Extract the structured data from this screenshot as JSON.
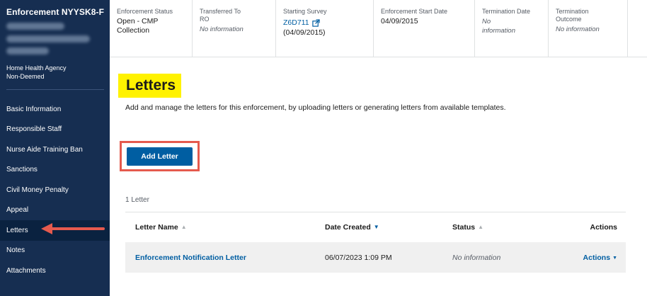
{
  "sidebar": {
    "title": "Enforcement NYYSK8-F",
    "meta_line1": "Home Health Agency",
    "meta_line2": "Non-Deemed",
    "items": [
      {
        "label": "Basic Information"
      },
      {
        "label": "Responsible Staff"
      },
      {
        "label": "Nurse Aide Training Ban"
      },
      {
        "label": "Sanctions"
      },
      {
        "label": "Civil Money Penalty"
      },
      {
        "label": "Appeal"
      },
      {
        "label": "Letters"
      },
      {
        "label": "Notes"
      },
      {
        "label": "Attachments"
      }
    ],
    "active_item": "Letters"
  },
  "infobar": {
    "enforcement_status": {
      "label": "Enforcement Status",
      "value": "Open - CMP Collection"
    },
    "transferred_to": {
      "label": "Transferred To RO",
      "value": "No information"
    },
    "starting_survey": {
      "label": "Starting Survey",
      "value": "Z6D711",
      "date": "(04/09/2015)"
    },
    "enforcement_start": {
      "label": "Enforcement Start Date",
      "value": "04/09/2015"
    },
    "termination_date": {
      "label": "Termination Date",
      "value": "No information"
    },
    "termination_outcome": {
      "label": "Termination Outcome",
      "value": "No information"
    }
  },
  "main": {
    "title": "Letters",
    "description": "Add and manage the letters for this enforcement, by uploading letters or generating letters from available templates.",
    "add_button": "Add Letter",
    "count_label": "1 Letter",
    "table": {
      "headers": {
        "name": "Letter Name",
        "date": "Date Created",
        "status": "Status",
        "actions": "Actions"
      },
      "rows": [
        {
          "name": "Enforcement Notification Letter",
          "date": "06/07/2023 1:09 PM",
          "status": "No information",
          "actions": "Actions"
        }
      ]
    }
  },
  "colors": {
    "sidebar_bg": "#162e51",
    "primary": "#005ea2",
    "highlight": "#fff200",
    "annotation": "#e55a4e"
  }
}
